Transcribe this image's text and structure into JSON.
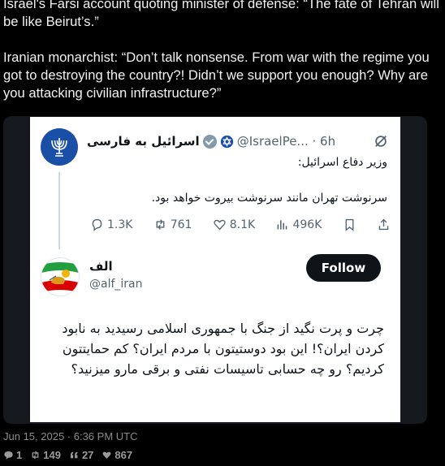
{
  "post": {
    "paragraph1": "Israel's Farsi account quoting minister of defense: “The fate of Tehran will be like Beirut’s.”",
    "paragraph2": "Iranian monarchist: “Don’t talk nonsense. From war with the regime you got to destroying the country?! Didn’t we support you enough? Why are you attacking civilian infrastructure?”",
    "date": "Jun 15, 2025 · 6:36 PM UTC",
    "stats": {
      "replies": "1",
      "retweets": "149",
      "quotes": "27",
      "likes": "867"
    }
  },
  "screenshot": {
    "tweet1": {
      "display_name": "اسرائیل به فارسی",
      "handle": "@IsraelPe... · 6h",
      "subheading": "وزیر دفاع اسرائیل:",
      "body": "سرنوشت تهران مانند سرنوشت بیروت خواهد بود.",
      "actions": {
        "replies": "1.3K",
        "retweets": "761",
        "likes": "8.1K",
        "views": "496K"
      }
    },
    "tweet2": {
      "display_name": "الف",
      "handle": "@alf_iran",
      "follow_label": "Follow",
      "body": "چرت و پرت نگید از جنگ با جمهوری اسلامی رسیدید به نابود کردن ایران؟! این بود دوستیتون با مردم ایران؟ کم حمایتتون کردیم؟ رو چه حسابی تاسیسات نفتی و برقی مارو میزنید؟"
    }
  },
  "colors": {
    "background": "#000000",
    "embed": "#15181c",
    "accent_blue": "#1a4fa8",
    "secondary": "#536471"
  }
}
